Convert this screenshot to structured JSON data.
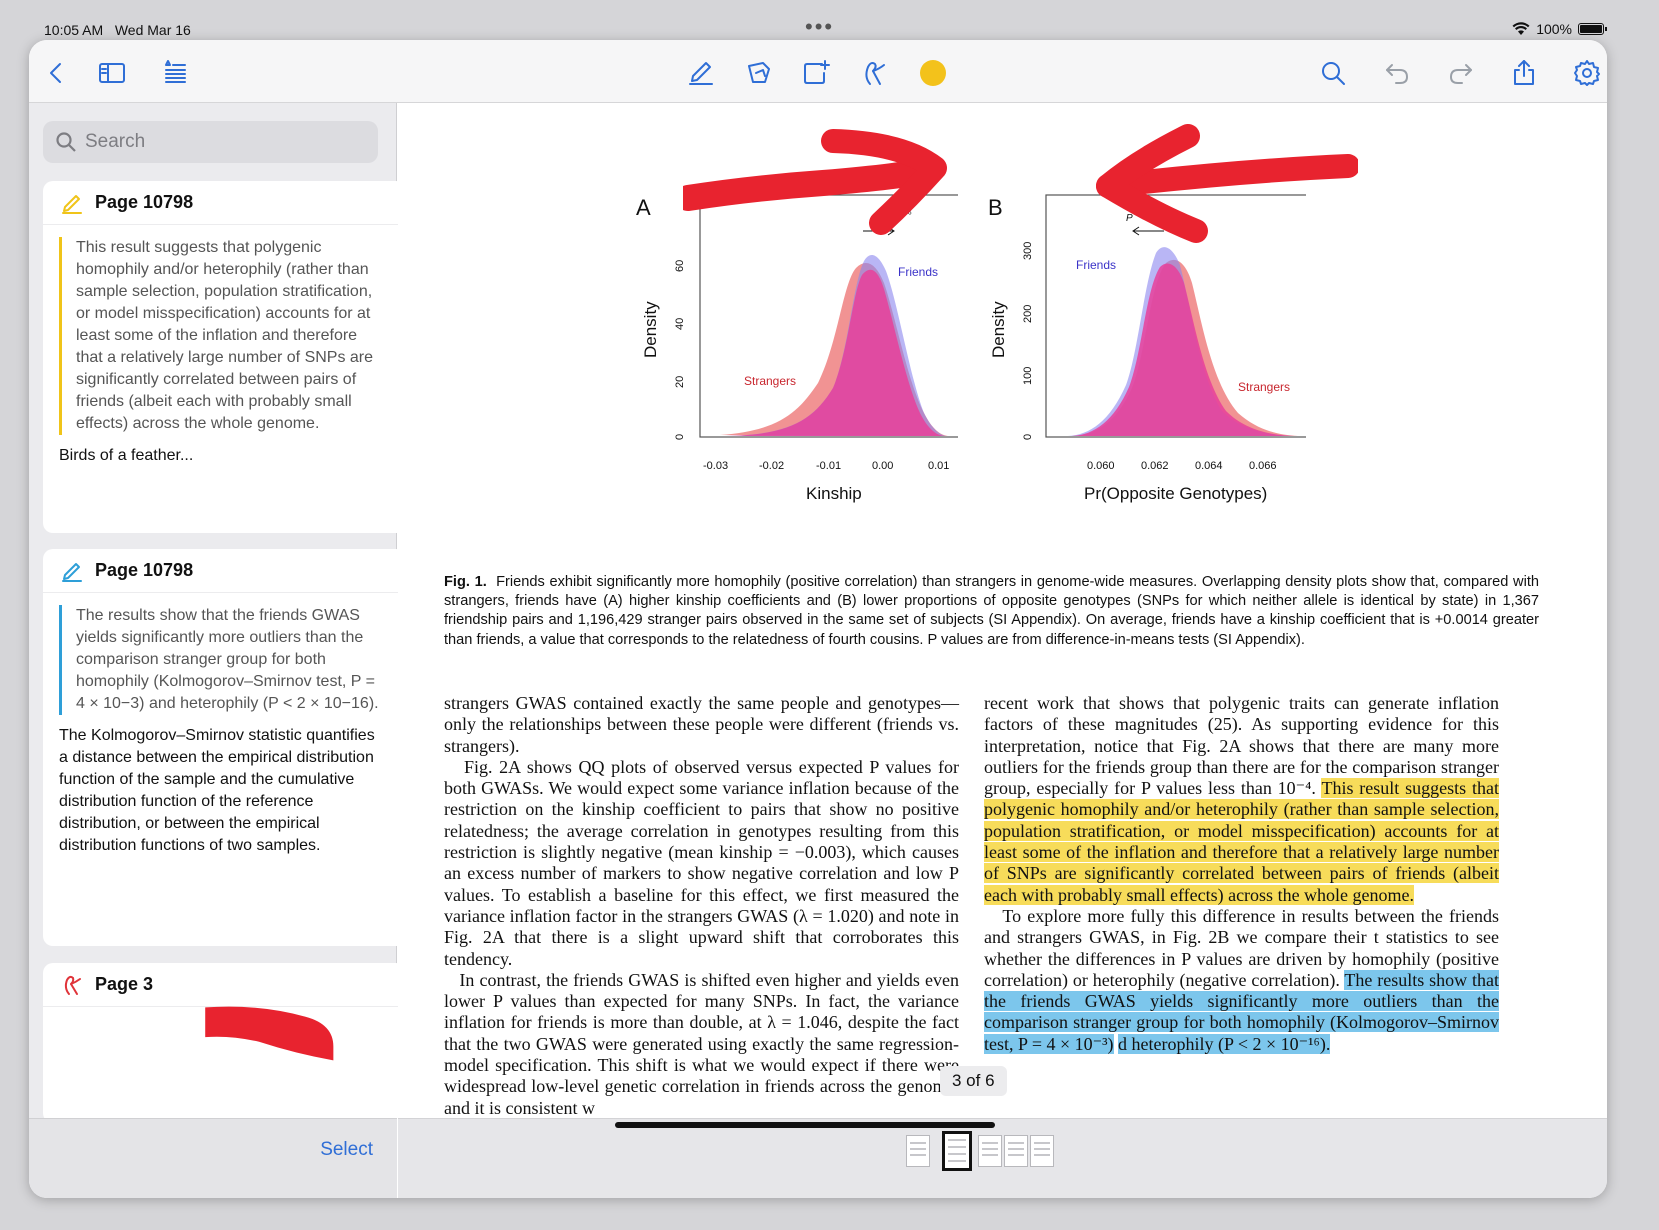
{
  "status": {
    "time": "10:05 AM",
    "date": "Wed Mar 16",
    "battery": "100%"
  },
  "toolbar": {
    "left": [
      "back-icon",
      "sidebar-toggle-icon",
      "outline-icon"
    ],
    "center": [
      "pen-icon",
      "eraser-icon",
      "lasso-add-icon",
      "highlighter-icon"
    ],
    "color": "#f3c21b",
    "right": [
      "search-icon",
      "undo-icon",
      "redo-icon",
      "share-icon",
      "settings-icon"
    ]
  },
  "sidebar": {
    "search_placeholder": "Search",
    "cards": [
      {
        "title": "Page 10798",
        "icon": "highlighter-icon",
        "color": "#f0c419",
        "quote": "This result suggests that polygenic homophily and/or heterophily (rather than sample selection, population stratification, or model misspecification) accounts for at least some of the inflation and therefore that a relatively large number of SNPs are significantly correlated between pairs of friends (albeit each with probably small effects) across the whole genome.",
        "note": "Birds of a feather..."
      },
      {
        "title": "Page 10798",
        "icon": "highlighter-icon",
        "color": "#2e9fd8",
        "quote": "The results show that the friends GWAS yields significantly more outliers than the comparison stranger group for both homophily (Kolmogorov–Smirnov test, P = 4 × 10−3) and heterophily (P < 2 × 10−16).",
        "note": "The Kolmogorov–Smirnov statistic quantifies a distance between the empirical distribution function of the sample and the cumulative distribution function of the reference distribution, or between the empirical distribution functions of two samples."
      },
      {
        "title": "Page 3",
        "icon": "pen-icon",
        "color": "#e0343a"
      }
    ],
    "select_label": "Select"
  },
  "figure": {
    "panel_a": {
      "label": "A",
      "ylabel": "Density",
      "xlabel": "Kinship",
      "xticks": [
        "-0.03",
        "-0.02",
        "-0.01",
        "0.00",
        "0.01"
      ],
      "yticks": [
        "0",
        "20",
        "40",
        "60"
      ],
      "series": [
        "Friends",
        "Strangers"
      ],
      "annotation": "10⁻¹⁶"
    },
    "panel_b": {
      "label": "B",
      "ylabel": "Density",
      "xlabel": "Pr(Opposite Genotypes)",
      "xticks": [
        "0.060",
        "0.062",
        "0.064",
        "0.066"
      ],
      "yticks": [
        "0",
        "100",
        "200",
        "300"
      ],
      "series": [
        "Friends",
        "Strangers"
      ],
      "annotation": "P"
    },
    "friends_color": "#8a86ee",
    "strangers_color": "#ef8080"
  },
  "caption": {
    "lead": "Fig. 1.",
    "text": "Friends exhibit significantly more homophily (positive correlation) than strangers in genome-wide measures. Overlapping density plots show that, compared with strangers, friends have (A) higher kinship coefficients and (B) lower proportions of opposite genotypes (SNPs for which neither allele is identical by state) in 1,367 friendship pairs and 1,196,429 stranger pairs observed in the same set of subjects (SI Appendix). On average, friends have a kinship coefficient that is +0.0014 greater than friends, a value that corresponds to the relatedness of fourth cousins. P values are from difference-in-means tests (SI Appendix)."
  },
  "body": {
    "left_p1": "strangers GWAS contained exactly the same people and genotypes—only the relationships between these people were different (friends vs. strangers).",
    "left_p2": "Fig. 2A shows QQ plots of observed versus expected P values for both GWASs. We would expect some variance inflation because of the restriction on the kinship coefficient to pairs that show no positive relatedness; the average correlation in genotypes resulting from this restriction is slightly negative (mean kinship = −0.003), which causes an excess number of markers to show negative correlation and low P values. To establish a baseline for this effect, we first measured the variance inflation factor in the strangers GWAS (λ = 1.020) and note in Fig. 2A that there is a slight upward shift that corroborates this tendency.",
    "left_p3": "In contrast, the friends GWAS is shifted even higher and yields even lower P values than expected for many SNPs. In fact, the variance inflation for friends is more than double, at λ = 1.046, despite the fact that the two GWAS were generated using exactly the same regression-model specification. This shift is what we would expect if there were widespread low-level genetic correlation in friends across the genome, and it is consistent w",
    "right_p1_plain": "recent work that shows that polygenic traits can generate inflation factors of these magnitudes (25). As supporting evidence for this interpretation, notice that Fig. 2A shows that there are many more outliers for the friends group than there are for the comparison stranger group, especially for P values less than 10⁻⁴.",
    "right_p1_highlight": "This result suggests that polygenic homophily and/or heterophily (rather than sample selection, population stratification, or model misspecification) accounts for at least some of the inflation and therefore that a relatively large number of SNPs are significantly correlated between pairs of friends (albeit each with probably small effects) across the whole genome.",
    "right_p2_plain": "To explore more fully this difference in results between the friends and strangers GWAS, in Fig. 2B we compare their t statistics to see whether the differences in P values are driven by homophily (positive correlation) or heterophily (negative correlation).",
    "right_p2_highlight": "The results show that the friends GWAS yields significantly more outliers than the comparison stranger group for both homophily (Kolmogorov–Smirnov test, P = 4 × 10⁻³)",
    "right_p2_tail": "d heterophily (P < 2 × 10⁻¹⁶)."
  },
  "pager": {
    "label": "3 of 6",
    "current": 3,
    "total": 6
  },
  "annotation_color": "#e8232f"
}
